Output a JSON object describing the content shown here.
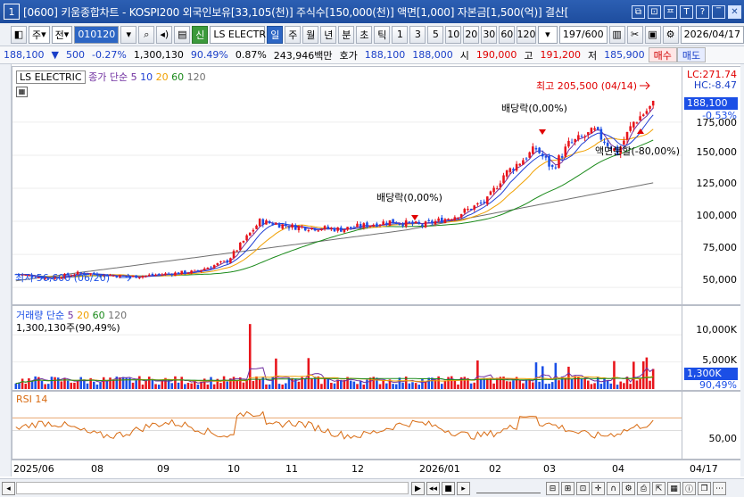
{
  "window": {
    "number": "1",
    "title": "[0600] 키움종합차트 - KOSPI200 외국인보유[33,105(천)] 주식수[150,000(천)] 액면[1,000] 자본금[1,500(억)] 결산[",
    "btn_restore": "⧉",
    "btn_link": "⊡",
    "btn_pin": "ᄑ",
    "btn_tab": "T",
    "btn_help": "?",
    "btn_min": "‾",
    "btn_close": "✕"
  },
  "toolbar": {
    "market": "주",
    "prev_label": "전",
    "code": "010120",
    "credit_label": "신",
    "stock_name": "LS ELECTRI",
    "periods": [
      "일",
      "주",
      "월",
      "년",
      "분",
      "초",
      "틱"
    ],
    "selected_period": "일",
    "intervals": [
      "1",
      "3",
      "5",
      "10",
      "20",
      "30",
      "60",
      "120"
    ],
    "count": "197",
    "count_total": "/600",
    "date": "2026/04/17"
  },
  "quote": {
    "price": "188,100",
    "change": "500",
    "change_pct": "-0.27%",
    "volume": "1,300,130",
    "volume_ratio": "90.49%",
    "turnover": "0.87%",
    "amount": "243,946백만",
    "hoga_label": "호가",
    "ask": "188,100",
    "bid": "188,000",
    "open_label": "시",
    "open": "190,000",
    "high_label": "고",
    "high": "191,200",
    "low_label": "저",
    "low": "185,900",
    "buy": "매수",
    "sell": "매도"
  },
  "price_pane": {
    "stock_label": "LS ELECTRIC",
    "ma_label": "종가 단순",
    "ma_periods": [
      "5",
      "10",
      "20",
      "60",
      "120"
    ],
    "lc": "LC:271.74",
    "hc": "HC:-8.47",
    "current_price": "188,100",
    "current_pct": "-0.53%",
    "y_ticks": [
      "175,000",
      "150,000",
      "125,000",
      "100,000",
      "75,000",
      "50,000"
    ],
    "annotations": {
      "high": "최고 205,500 (04/14)",
      "low": "최저 56,600 (06/20)",
      "dividend1": "배당락(0,00%)",
      "dividend2": "배당락(0,00%)",
      "split": "액면분할(-80,00%)"
    }
  },
  "volume_pane": {
    "label": "거래량 단순",
    "ma_periods": [
      "5",
      "20",
      "60",
      "120"
    ],
    "value_line": "1,300,130주(90,49%)",
    "y_ticks": [
      "10,000K",
      "5,000K"
    ],
    "current": "1,300K",
    "current_pct": "90,49%"
  },
  "rsi_pane": {
    "label": "RSI 14",
    "y_ticks": [
      "50,00"
    ]
  },
  "time_axis": {
    "labels": [
      "2025/06",
      "08",
      "09",
      "10",
      "11",
      "12",
      "2026/01",
      "02",
      "03",
      "04"
    ],
    "end_label": "04/17"
  },
  "colors": {
    "up": "#e8141b",
    "down": "#1b4fe6",
    "ma5": "#7030a0",
    "ma10": "#1f3fd4",
    "ma20": "#f0a000",
    "ma60": "#1a8a1a",
    "ma120": "#707070",
    "rsi": "#d86a10"
  }
}
